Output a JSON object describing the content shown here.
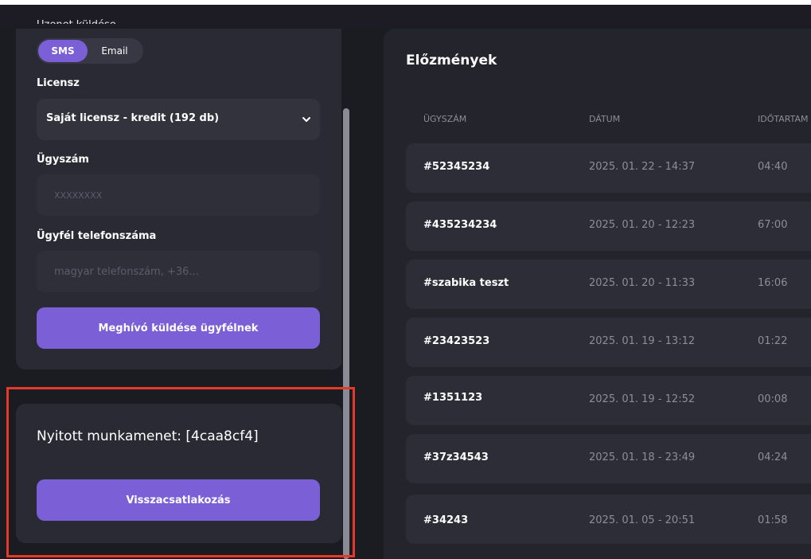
{
  "left_panel": {
    "cut_label": "Üzenet küldése",
    "channel_options": [
      "SMS",
      "Email"
    ],
    "license_label": "Licensz",
    "license_value": "Saját licensz - kredit (192 db)",
    "case_label": "Ügyszám",
    "case_placeholder": "XXXXXXXX",
    "phone_label": "Ügyfél telefonszáma",
    "phone_placeholder": "magyar telefonszám, +36...",
    "invite_button": "Meghívó küldése ügyfélnek"
  },
  "session": {
    "title": "Nyitott munkamenet: [4caa8cf4]",
    "rejoin_button": "Visszacsatlakozás"
  },
  "history": {
    "title": "Előzmények",
    "columns": [
      "ÜGYSZÁM",
      "DÁTUM",
      "IDŐTARTAM"
    ],
    "rows": [
      {
        "id": "#52345234",
        "date": "2025. 01. 22 - 14:37",
        "duration": "04:40"
      },
      {
        "id": "#435234234",
        "date": "2025. 01. 20 - 12:23",
        "duration": "67:00"
      },
      {
        "id": "#szabika teszt",
        "date": "2025. 01. 20 - 11:33",
        "duration": "16:06"
      },
      {
        "id": "#23423523",
        "date": "2025. 01. 19 - 13:12",
        "duration": "01:22"
      },
      {
        "id": "#1351123",
        "date": "2025. 01. 19 - 12:52",
        "duration": "00:08"
      },
      {
        "id": "#37z34543",
        "date": "2025. 01. 18 - 23:49",
        "duration": "04:24"
      },
      {
        "id": "#34243",
        "date": "2025. 01. 05 - 20:51",
        "duration": "01:58"
      }
    ]
  },
  "colors": {
    "accent": "#7b5fd6",
    "background": "#1b1b22",
    "card": "#2a2a34",
    "row": "#2d2d38",
    "highlight": "#e53a2a"
  },
  "icons": [
    "chevron-down-icon"
  ]
}
